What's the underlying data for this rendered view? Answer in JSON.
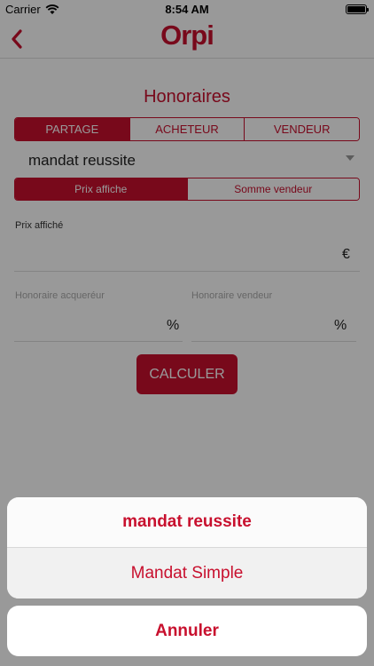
{
  "status_bar": {
    "carrier": "Carrier",
    "time": "8:54 AM",
    "battery_level": 1.0
  },
  "nav": {
    "logo": "Orpi",
    "back_icon": "chevron-left-icon"
  },
  "page": {
    "title": "Honoraires"
  },
  "tabs": [
    {
      "label": "PARTAGE",
      "active": true
    },
    {
      "label": "ACHETEUR",
      "active": false
    },
    {
      "label": "VENDEUR",
      "active": false
    }
  ],
  "picker": {
    "value": "mandat reussite"
  },
  "price_tabs": [
    {
      "label": "Prix affiche",
      "active": true
    },
    {
      "label": "Somme vendeur",
      "active": false
    }
  ],
  "fields": {
    "prix_label": "Prix affiché",
    "prix_unit": "€",
    "acquereur_label": "Honoraire acqueréur",
    "acquereur_unit": "%",
    "vendeur_label": "Honoraire vendeur",
    "vendeur_unit": "%"
  },
  "calc_button": {
    "label": "CALCULER"
  },
  "action_sheet": {
    "options": [
      {
        "label": "mandat reussite",
        "selected": true
      },
      {
        "label": "Mandat Simple",
        "selected": false
      }
    ],
    "cancel_label": "Annuler"
  },
  "colors": {
    "brand": "#c8102e",
    "overlay": "rgba(0,0,0,0.4)"
  }
}
